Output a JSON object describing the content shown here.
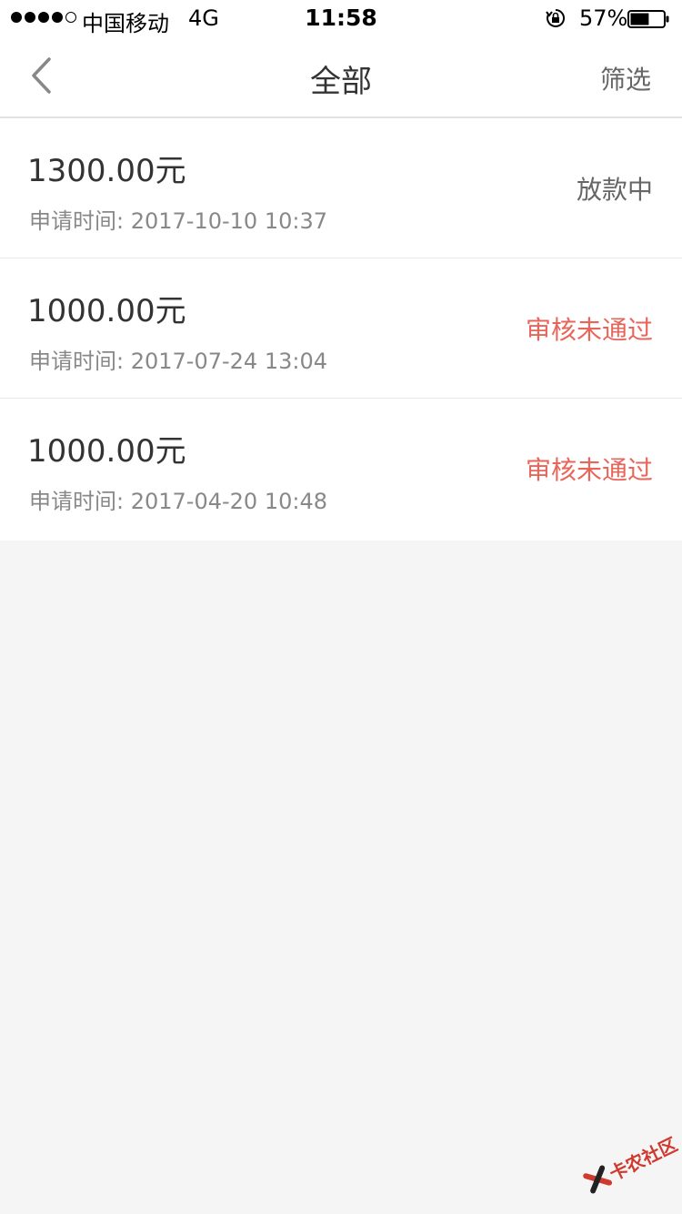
{
  "status_bar": {
    "carrier": "中国移动",
    "network": "4G",
    "time": "11:58",
    "battery_percent": "57%",
    "battery_level": 0.57
  },
  "nav": {
    "title": "全部",
    "filter_label": "筛选",
    "back_icon": "chevron-left-icon"
  },
  "records": [
    {
      "amount": "1300.00元",
      "apply_time": "申请时间: 2017-10-10 10:37",
      "status": "放款中",
      "status_color": "#666666"
    },
    {
      "amount": "1000.00元",
      "apply_time": "申请时间: 2017-07-24 13:04",
      "status": "审核未通过",
      "status_color": "#e8655a"
    },
    {
      "amount": "1000.00元",
      "apply_time": "申请时间: 2017-04-20 10:48",
      "status": "审核未通过",
      "status_color": "#e8655a"
    }
  ],
  "watermark": {
    "text": "卡农社区"
  },
  "colors": {
    "background": "#f5f5f5",
    "card": "#ffffff",
    "text_primary": "#333333",
    "text_secondary": "#888888",
    "rejected": "#e8655a"
  }
}
